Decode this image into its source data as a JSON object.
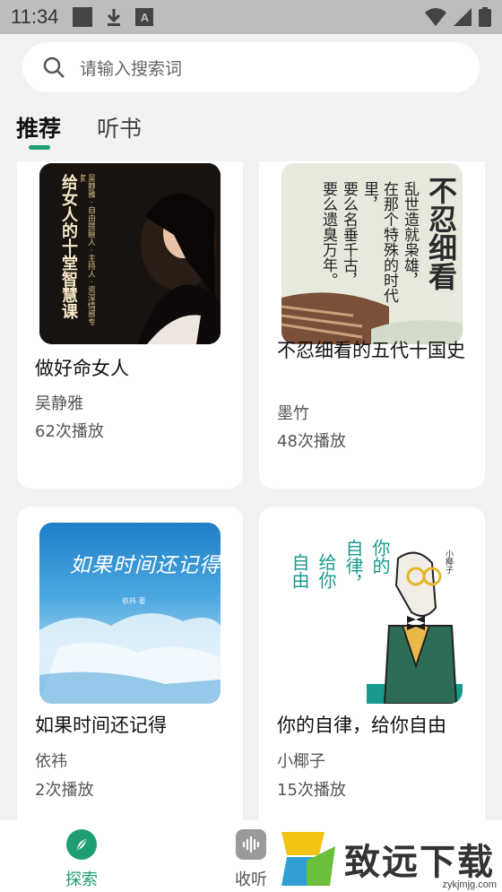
{
  "status_bar": {
    "time": "11:34",
    "a_glyph": "A"
  },
  "search": {
    "placeholder": "请输入搜索词"
  },
  "tabs": [
    {
      "label": "推荐",
      "active": true
    },
    {
      "label": "听书",
      "active": false
    }
  ],
  "books": [
    {
      "title": "做好命女人",
      "author": "吴静雅",
      "plays": "62次播放",
      "cover": {
        "main_text": "给女人的十堂智慧课",
        "side_text": "吴静雅 · 自由撰稿人 · 主持人 · 资深情感专家"
      }
    },
    {
      "title": "不忍细看的五代十国史",
      "author": "墨竹",
      "plays": "48次播放",
      "cover": {
        "big_text": "不忍细看",
        "poem": [
          "乱世造就枭雄，",
          "在那个特殊的时代里，",
          "要么名垂千古，",
          "要么遗臭万年。"
        ]
      }
    },
    {
      "title": "如果时间还记得",
      "author": "依祎",
      "plays": "2次播放",
      "cover": {
        "script_text": "如果时间还记得",
        "small_author": "依祎 著"
      }
    },
    {
      "title": "你的自律，给你自由",
      "author": "小椰子",
      "plays": "15次播放",
      "cover": {
        "vertical_text": [
          "你的",
          "自律，",
          "给你",
          "自由"
        ],
        "small_author": "小椰子"
      }
    }
  ],
  "bottom_nav": [
    {
      "label": "探索",
      "icon": "compass-icon",
      "active": true
    },
    {
      "label": "收听",
      "icon": "audio-wave-icon",
      "active": false
    }
  ],
  "watermark": {
    "text": "致远下载",
    "url": "zykjmjg.com"
  },
  "colors": {
    "accent": "#1f9d75",
    "background": "#f2f2f4",
    "status_bar": "#bdbdbd"
  }
}
